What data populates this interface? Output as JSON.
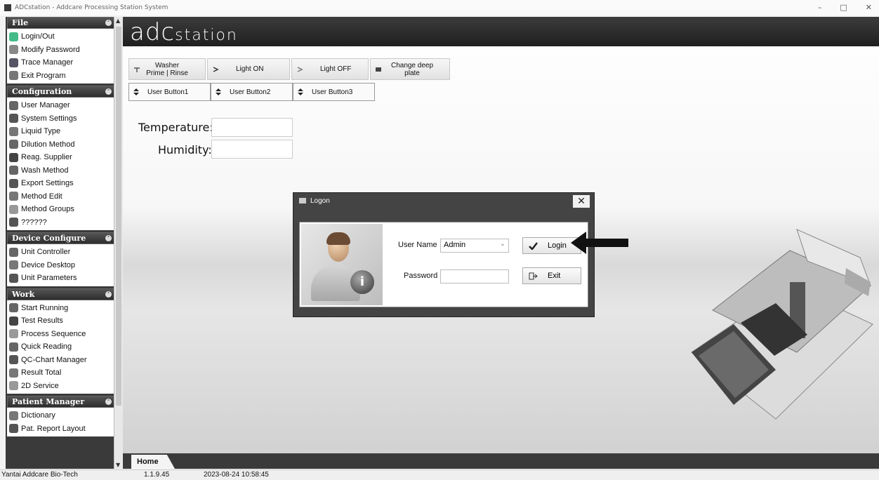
{
  "window": {
    "title": "ADCstation - Addcare Processing Station System",
    "minimize": "–",
    "maximize": "□",
    "close": "✕"
  },
  "sidebar": {
    "groups": [
      {
        "title": "File",
        "items": [
          {
            "label": "Login/Out",
            "icon": "login-icon",
            "color": "#4b8"
          },
          {
            "label": "Modify Password",
            "icon": "key-icon",
            "color": "#888"
          },
          {
            "label": "Trace Manager",
            "icon": "trace-icon",
            "color": "#556"
          },
          {
            "label": "Exit Program",
            "icon": "exit-icon",
            "color": "#777"
          }
        ]
      },
      {
        "title": "Configuration",
        "items": [
          {
            "label": "User Manager",
            "icon": "users-icon",
            "color": "#666"
          },
          {
            "label": "System Settings",
            "icon": "settings-icon",
            "color": "#555"
          },
          {
            "label": "Liquid Type",
            "icon": "liquid-icon",
            "color": "#777"
          },
          {
            "label": "Dilution Method",
            "icon": "dilution-icon",
            "color": "#666"
          },
          {
            "label": "Reag. Supplier",
            "icon": "supplier-icon",
            "color": "#444"
          },
          {
            "label": "Wash Method",
            "icon": "wash-icon",
            "color": "#666"
          },
          {
            "label": "Export Settings",
            "icon": "export-icon",
            "color": "#555"
          },
          {
            "label": "Method Edit",
            "icon": "edit-icon",
            "color": "#777"
          },
          {
            "label": "Method Groups",
            "icon": "groups-icon",
            "color": "#999"
          },
          {
            "label": "??????",
            "icon": "unknown-icon",
            "color": "#555"
          }
        ]
      },
      {
        "title": "Device Configure",
        "items": [
          {
            "label": "Unit Controller",
            "icon": "controller-icon",
            "color": "#666"
          },
          {
            "label": "Device Desktop",
            "icon": "desktop-icon",
            "color": "#777"
          },
          {
            "label": "Unit Parameters",
            "icon": "parameters-icon",
            "color": "#555"
          }
        ]
      },
      {
        "title": "Work",
        "items": [
          {
            "label": "Start Running",
            "icon": "run-icon",
            "color": "#666"
          },
          {
            "label": "Test Results",
            "icon": "results-icon",
            "color": "#444"
          },
          {
            "label": "Process Sequence",
            "icon": "sequence-icon",
            "color": "#999"
          },
          {
            "label": "Quick Reading",
            "icon": "reading-icon",
            "color": "#666"
          },
          {
            "label": "QC-Chart Manager",
            "icon": "qc-chart-icon",
            "color": "#555"
          },
          {
            "label": "Result Total",
            "icon": "total-icon",
            "color": "#777"
          },
          {
            "label": "2D Service",
            "icon": "service-icon",
            "color": "#999"
          }
        ]
      },
      {
        "title": "Patient Manager",
        "items": [
          {
            "label": "Dictionary",
            "icon": "dictionary-icon",
            "color": "#777"
          },
          {
            "label": "Pat. Report Layout",
            "icon": "report-icon",
            "color": "#555"
          }
        ]
      }
    ]
  },
  "header": {
    "logo_main": "adc",
    "logo_sub": "station"
  },
  "toolbar": {
    "washer": "Washer Prime | Rinse",
    "light_on": "Light ON",
    "light_off": "Light OFF",
    "change_plate": "Change deep plate",
    "user1": "User Button1",
    "user2": "User Button2",
    "user3": "User Button3"
  },
  "env": {
    "temperature_label": "Temperature:",
    "humidity_label": "Humidity:",
    "temperature_value": "",
    "humidity_value": ""
  },
  "logon": {
    "title": "Logon",
    "username_label": "User Name",
    "username_value": "Admin",
    "password_label": "Password",
    "password_value": "",
    "login_button": "Login",
    "exit_button": "Exit",
    "close": "✕"
  },
  "tabs": [
    {
      "label": "Home"
    }
  ],
  "status": {
    "company": "Yantai Addcare Bio-Tech",
    "version": "1.1.9.45",
    "datetime": "2023-08-24 10:58:45"
  }
}
